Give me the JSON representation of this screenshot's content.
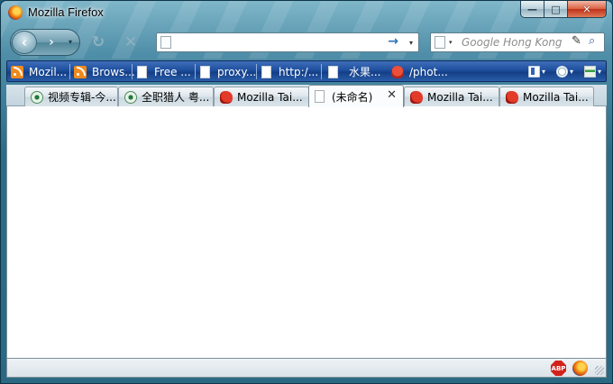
{
  "window": {
    "title": "Mozilla Firefox",
    "accent": "#2b6983",
    "caption": {
      "minimize": "—",
      "maximize": "□",
      "close": "✕"
    }
  },
  "navbar": {
    "back_glyph": "‹",
    "forward_glyph": "›",
    "history_dropdown": "▾",
    "reload_glyph": "↻",
    "stop_glyph": "✕",
    "url": {
      "value": "",
      "placeholder": "",
      "go_glyph": "→",
      "dropdown": "▾"
    },
    "search": {
      "value": "",
      "placeholder": "Google Hong Kong",
      "engine_dropdown": "▾",
      "highlight_glyph": "✎",
      "search_glyph": "⌕"
    }
  },
  "bookmarks": [
    {
      "label": "Mozil...",
      "icon": "rss"
    },
    {
      "label": "Brows...",
      "icon": "rss"
    },
    {
      "label": "Free ...",
      "icon": "page"
    },
    {
      "label": "proxy...",
      "icon": "page"
    },
    {
      "label": "http:/...",
      "icon": "page"
    },
    {
      "label": "水果...",
      "icon": "page"
    },
    {
      "label": "/phot...",
      "icon": "octopus"
    }
  ],
  "bookmark_tools": [
    {
      "name": "sidebar",
      "dropdown": "▾"
    },
    {
      "name": "history",
      "dropdown": "▾"
    },
    {
      "name": "extensions",
      "dropdown": "▾"
    }
  ],
  "tabs": [
    {
      "label": "视频专辑-今...",
      "favicon": "globe",
      "active": false
    },
    {
      "label": "全职猎人 粤...",
      "favicon": "globe",
      "active": false
    },
    {
      "label": "Mozilla Tai...",
      "favicon": "mozilla",
      "active": false
    },
    {
      "label": "(未命名)",
      "favicon": "blank",
      "active": true,
      "close_glyph": "✕"
    },
    {
      "label": "Mozilla Tai...",
      "favicon": "mozilla",
      "active": false
    },
    {
      "label": "Mozilla Tai...",
      "favicon": "mozilla",
      "active": false
    }
  ],
  "statusbar": {
    "adblock_label": "ABP"
  }
}
